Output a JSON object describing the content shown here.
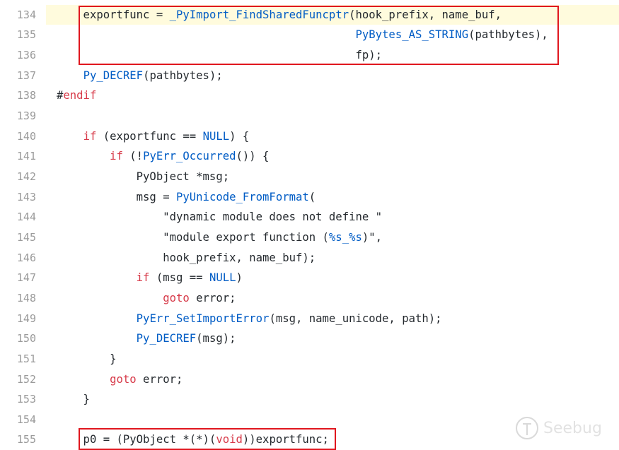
{
  "highlight_line": 134,
  "lines": [
    {
      "n": "134",
      "t": [
        [
          "    exportfunc = ",
          ""
        ],
        [
          "_PyImport_FindSharedFuncptr",
          "fn"
        ],
        [
          "(hook_prefix, name_buf,",
          ""
        ]
      ]
    },
    {
      "n": "135",
      "t": [
        [
          "                                             ",
          ""
        ],
        [
          "PyBytes_AS_STRING",
          "fn"
        ],
        [
          "(pathbytes),",
          ""
        ]
      ]
    },
    {
      "n": "136",
      "t": [
        [
          "                                             fp);",
          ""
        ]
      ]
    },
    {
      "n": "137",
      "t": [
        [
          "    ",
          ""
        ],
        [
          "Py_DECREF",
          "fn"
        ],
        [
          "(pathbytes);",
          ""
        ]
      ]
    },
    {
      "n": "138",
      "t": [
        [
          "#",
          ""
        ],
        [
          "endif",
          "kw"
        ]
      ]
    },
    {
      "n": "139",
      "t": []
    },
    {
      "n": "140",
      "t": [
        [
          "    ",
          ""
        ],
        [
          "if",
          "kw"
        ],
        [
          " (exportfunc == ",
          ""
        ],
        [
          "NULL",
          "c"
        ],
        [
          ") {",
          ""
        ]
      ]
    },
    {
      "n": "141",
      "t": [
        [
          "        ",
          ""
        ],
        [
          "if",
          "kw"
        ],
        [
          " (!",
          ""
        ],
        [
          "PyErr_Occurred",
          "fn"
        ],
        [
          "()) {",
          ""
        ]
      ]
    },
    {
      "n": "142",
      "t": [
        [
          "            PyObject *msg;",
          ""
        ]
      ]
    },
    {
      "n": "143",
      "t": [
        [
          "            msg = ",
          ""
        ],
        [
          "PyUnicode_FromFormat",
          "fn"
        ],
        [
          "(",
          ""
        ]
      ]
    },
    {
      "n": "144",
      "t": [
        [
          "                \"dynamic module does not define \"",
          ""
        ]
      ]
    },
    {
      "n": "145",
      "t": [
        [
          "                \"module export function (",
          ""
        ],
        [
          "%s_%s",
          "c"
        ],
        [
          ")\",",
          ""
        ]
      ]
    },
    {
      "n": "146",
      "t": [
        [
          "                hook_prefix, name_buf);",
          ""
        ]
      ]
    },
    {
      "n": "147",
      "t": [
        [
          "            ",
          ""
        ],
        [
          "if",
          "kw"
        ],
        [
          " (msg == ",
          ""
        ],
        [
          "NULL",
          "c"
        ],
        [
          ")",
          ""
        ]
      ]
    },
    {
      "n": "148",
      "t": [
        [
          "                ",
          ""
        ],
        [
          "goto",
          "kw"
        ],
        [
          " error;",
          ""
        ]
      ]
    },
    {
      "n": "149",
      "t": [
        [
          "            ",
          ""
        ],
        [
          "PyErr_SetImportError",
          "fn"
        ],
        [
          "(msg, name_unicode, path);",
          ""
        ]
      ]
    },
    {
      "n": "150",
      "t": [
        [
          "            ",
          ""
        ],
        [
          "Py_DECREF",
          "fn"
        ],
        [
          "(msg);",
          ""
        ]
      ]
    },
    {
      "n": "151",
      "t": [
        [
          "        }",
          ""
        ]
      ]
    },
    {
      "n": "152",
      "t": [
        [
          "        ",
          ""
        ],
        [
          "goto",
          "kw"
        ],
        [
          " error;",
          ""
        ]
      ]
    },
    {
      "n": "153",
      "t": [
        [
          "    }",
          ""
        ]
      ]
    },
    {
      "n": "154",
      "t": []
    },
    {
      "n": "155",
      "t": [
        [
          "    p0 = (PyObject *(*)(",
          ""
        ],
        [
          "void",
          "kw"
        ],
        [
          "))exportfunc;",
          ""
        ]
      ]
    }
  ],
  "watermark": "Seebug",
  "colors": {
    "keyword": "#d73a49",
    "function": "#005cc5",
    "box": "#e0161e",
    "highlight": "#fffbdd"
  }
}
